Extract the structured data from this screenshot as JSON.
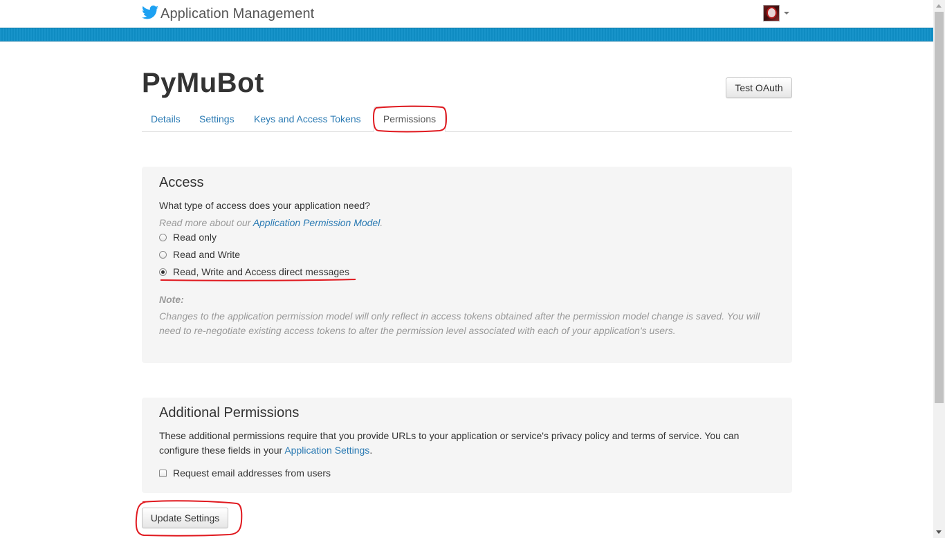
{
  "header": {
    "brand_icon": "twitter-bird-icon",
    "title": "Application Management",
    "accent_color": "#1da1f2",
    "bar_color": "#0f90c8"
  },
  "app": {
    "name": "PyMuBot",
    "test_oauth_label": "Test OAuth"
  },
  "tabs": [
    {
      "label": "Details"
    },
    {
      "label": "Settings"
    },
    {
      "label": "Keys and Access Tokens"
    },
    {
      "label": "Permissions",
      "active": true
    }
  ],
  "access": {
    "heading": "Access",
    "question": "What type of access does your application need?",
    "read_more_prefix": "Read more about our ",
    "read_more_link": "Application Permission Model",
    "read_more_suffix": ".",
    "options": [
      {
        "label": "Read only",
        "checked": false
      },
      {
        "label": "Read and Write",
        "checked": false
      },
      {
        "label": "Read, Write and Access direct messages",
        "checked": true
      }
    ],
    "note_label": "Note:",
    "note_text": "Changes to the application permission model will only reflect in access tokens obtained after the permission model change is saved. You will need to re-negotiate existing access tokens to alter the permission level associated with each of your application's users."
  },
  "additional": {
    "heading": "Additional Permissions",
    "description_prefix": "These additional permissions require that you provide URLs to your application or service's privacy policy and terms of service. You can configure these fields in your ",
    "description_link": "Application Settings",
    "description_suffix": ".",
    "email_checkbox_label": "Request email addresses from users",
    "email_checked": false
  },
  "actions": {
    "update_label": "Update Settings"
  },
  "annotation_color": "#e0191f"
}
